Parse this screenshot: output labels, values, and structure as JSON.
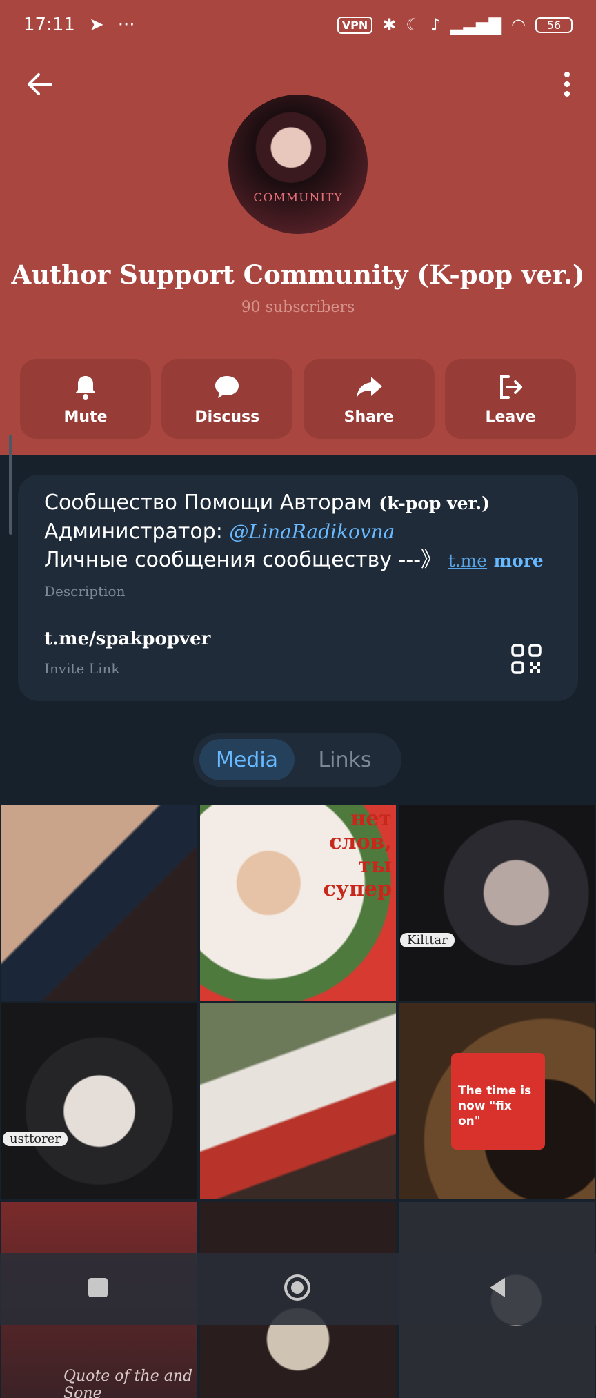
{
  "status_bar": {
    "time": "17:11",
    "more": "···",
    "vpn": "VPN",
    "battery": "56"
  },
  "channel": {
    "avatar_text": "COMMUNITY",
    "title": "Author Support Community (K-pop ver.)",
    "subscribers": "90 subscribers"
  },
  "actions": [
    {
      "label": "Mute",
      "icon": "bell-icon"
    },
    {
      "label": "Discuss",
      "icon": "chat-bubble-icon"
    },
    {
      "label": "Share",
      "icon": "share-arrow-icon"
    },
    {
      "label": "Leave",
      "icon": "leave-icon"
    }
  ],
  "info": {
    "desc_line1_main": "Сообщество Помощи Авторам ",
    "desc_line1_kpop": "(k-pop ver.)",
    "desc_line2_main": "Администратор: ",
    "desc_line2_mention": "@LinaRadikovna",
    "desc_line3_main": "Личные сообщения сообществу ---》 ",
    "desc_line3_link": "t.me",
    "more": "more",
    "desc_label": "Description",
    "invite_link": "t.me/spakpopver",
    "invite_label": "Invite Link"
  },
  "tabs": {
    "media": "Media",
    "links": "Links"
  },
  "media": {
    "t2_text_lines": [
      "нет",
      "слов,",
      "ты",
      "супер"
    ],
    "t3_label": "Kilttar",
    "t4_label": "usttorer",
    "t6_card_text": "The time is now \"fix on\"",
    "t7_text": "Quote of the and Sone"
  },
  "colors": {
    "header_bg": "#a8463f",
    "accent": "#68b9ff",
    "page_bg": "#17212b"
  }
}
